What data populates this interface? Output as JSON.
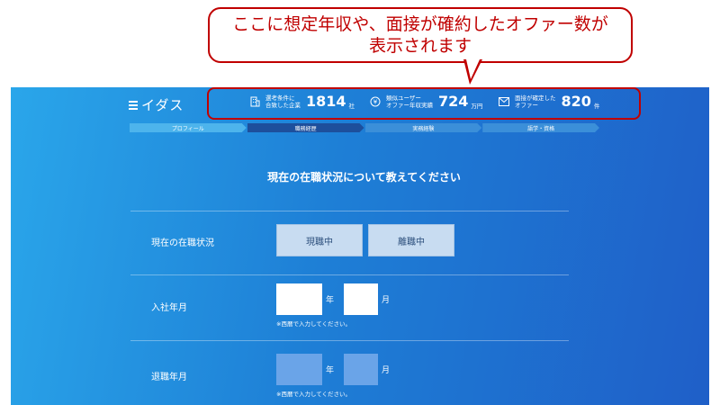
{
  "callout": {
    "line1": "ここに想定年収や、面接が確約したオファー数が",
    "line2": "表示されます"
  },
  "header": {
    "logo": "イダス",
    "stats": [
      {
        "icon": "building-icon",
        "label": "選考条件に\n合致した企業",
        "value": "1814",
        "unit": "社"
      },
      {
        "icon": "yen-icon",
        "label": "類似ユーザー\nオファー年収実績",
        "value": "724",
        "unit": "万円"
      },
      {
        "icon": "mail-icon",
        "label": "面接が確定した\nオファー",
        "value": "820",
        "unit": "件"
      }
    ]
  },
  "steps": [
    "プロフィール",
    "職務経歴",
    "実務経験",
    "語学・資格"
  ],
  "form": {
    "question": "現在の在職状況について教えてください",
    "status_label": "現在の在職状況",
    "options": [
      "現職中",
      "離職中"
    ],
    "join_label": "入社年月",
    "leave_label": "退職年月",
    "year_unit": "年",
    "month_unit": "月",
    "note": "※西暦で入力してください。"
  },
  "colors": {
    "callout_red": "#c00000",
    "active_step": "#1d4f9c",
    "step": "#4db4ec"
  }
}
